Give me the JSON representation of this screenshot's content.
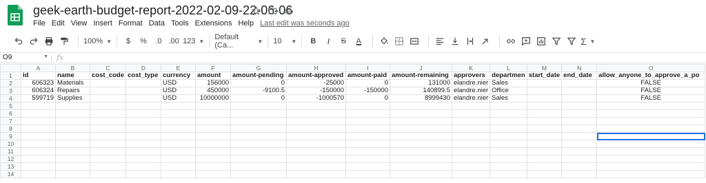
{
  "doc": {
    "title": "geek-earth-budget-report-2022-02-09-22-06-06",
    "last_edit": "Last edit was seconds ago"
  },
  "menu": [
    "File",
    "Edit",
    "View",
    "Insert",
    "Format",
    "Data",
    "Tools",
    "Extensions",
    "Help"
  ],
  "toolbar": {
    "zoom": "100%",
    "currency": "$",
    "percent": "%",
    "dec_decrease": ".0",
    "dec_increase": ".00",
    "more_formats": "123",
    "font": "Default (Ca...",
    "font_size": "10",
    "bold": "B",
    "italic": "I",
    "strike": "S",
    "textcolor": "A",
    "sigma": "Σ"
  },
  "formula_bar": {
    "cell_ref": "O9",
    "fx": "fx"
  },
  "columns": [
    "A",
    "B",
    "C",
    "D",
    "E",
    "F",
    "G",
    "H",
    "I",
    "J",
    "K",
    "L",
    "M",
    "N",
    "O"
  ],
  "rows": [
    [
      "id",
      "name",
      "cost_code",
      "cost_type",
      "currency",
      "amount",
      "amount-pending",
      "amount-approved",
      "amount-paid",
      "amount-remaining",
      "approvers",
      "departmen",
      "start_date",
      "end_date",
      "allow_anyone_to_approve_a_po"
    ],
    [
      "606323",
      "Materials",
      "",
      "",
      "USD",
      "156000",
      "0",
      "-25000",
      "0",
      "131000",
      "elandre.nier",
      "Sales",
      "",
      "",
      "FALSE"
    ],
    [
      "606324",
      "Repairs",
      "",
      "",
      "USD",
      "450000",
      "-9100.5",
      "-150000",
      "-150000",
      "140899.5",
      "elandre.nier",
      "Office",
      "",
      "",
      "FALSE"
    ],
    [
      "599719",
      "Supplies",
      "",
      "",
      "USD",
      "10000000",
      "0",
      "-1000570",
      "0",
      "8999430",
      "elandre.nier",
      "Sales",
      "",
      "",
      "FALSE"
    ],
    [
      "",
      "",
      "",
      "",
      "",
      "",
      "",
      "",
      "",
      "",
      "",
      "",
      "",
      "",
      ""
    ],
    [
      "",
      "",
      "",
      "",
      "",
      "",
      "",
      "",
      "",
      "",
      "",
      "",
      "",
      "",
      ""
    ],
    [
      "",
      "",
      "",
      "",
      "",
      "",
      "",
      "",
      "",
      "",
      "",
      "",
      "",
      "",
      ""
    ],
    [
      "",
      "",
      "",
      "",
      "",
      "",
      "",
      "",
      "",
      "",
      "",
      "",
      "",
      "",
      ""
    ],
    [
      "",
      "",
      "",
      "",
      "",
      "",
      "",
      "",
      "",
      "",
      "",
      "",
      "",
      "",
      ""
    ],
    [
      "",
      "",
      "",
      "",
      "",
      "",
      "",
      "",
      "",
      "",
      "",
      "",
      "",
      "",
      ""
    ],
    [
      "",
      "",
      "",
      "",
      "",
      "",
      "",
      "",
      "",
      "",
      "",
      "",
      "",
      "",
      ""
    ],
    [
      "",
      "",
      "",
      "",
      "",
      "",
      "",
      "",
      "",
      "",
      "",
      "",
      "",
      "",
      ""
    ],
    [
      "",
      "",
      "",
      "",
      "",
      "",
      "",
      "",
      "",
      "",
      "",
      "",
      "",
      "",
      ""
    ],
    [
      "",
      "",
      "",
      "",
      "",
      "",
      "",
      "",
      "",
      "",
      "",
      "",
      "",
      "",
      ""
    ]
  ],
  "selected_cell": "O9",
  "colors": {
    "brand_green": "#0f9d58",
    "selection_blue": "#1a73e8",
    "header_bg": "#f8f9fa"
  }
}
